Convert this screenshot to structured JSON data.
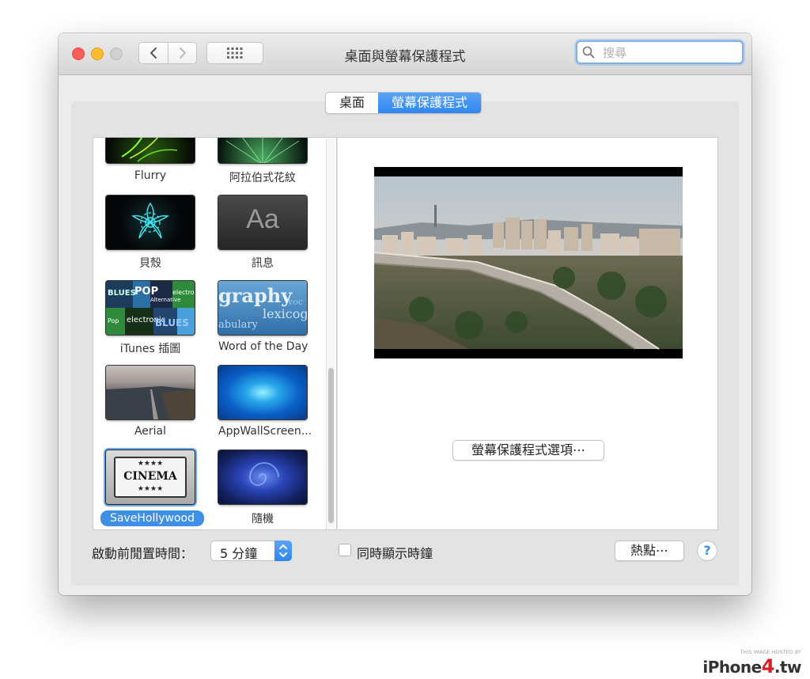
{
  "window": {
    "title": "桌面與螢幕保護程式"
  },
  "search": {
    "placeholder": "搜尋"
  },
  "tabs": [
    {
      "label": "桌面",
      "active": false
    },
    {
      "label": "螢幕保護程式",
      "active": true
    }
  ],
  "screensavers": [
    {
      "label": "Flurry"
    },
    {
      "label": "阿拉伯式花紋"
    },
    {
      "label": "貝殼"
    },
    {
      "label": "訊息",
      "thumb_text": "Aa"
    },
    {
      "label": "iTunes 插圖",
      "thumb_text": [
        "BLUES",
        "POP",
        "Alternative",
        "electronic",
        "Pop",
        "electronic",
        "BLUES"
      ]
    },
    {
      "label": "Word of the Day",
      "thumb_text": [
        "graphy",
        "voc",
        "lexicog",
        "abulary"
      ]
    },
    {
      "label": "Aerial"
    },
    {
      "label": "AppWallScreen..."
    },
    {
      "label": "SaveHollywood",
      "selected": true,
      "thumb_text": [
        "★★★★",
        "CINEMA",
        "★★★★"
      ]
    },
    {
      "label": "隨機"
    }
  ],
  "options_button": "螢幕保護程式選項⋯",
  "footer": {
    "idle_label": "啟動前閒置時間：",
    "idle_value": "5 分鐘",
    "clock_label": "同時顯示時鐘",
    "clock_checked": false,
    "hot_corners_button": "熱點⋯",
    "help_symbol": "?"
  },
  "colors": {
    "accent": "#3e8fe6",
    "close": "#fc5f57",
    "minimize": "#fdbc2e"
  },
  "watermark": {
    "small": "THIS IMAGE HOSTED BY",
    "brand_prefix": "iPhone",
    "brand_digit": "4",
    "brand_suffix": ".tw"
  }
}
